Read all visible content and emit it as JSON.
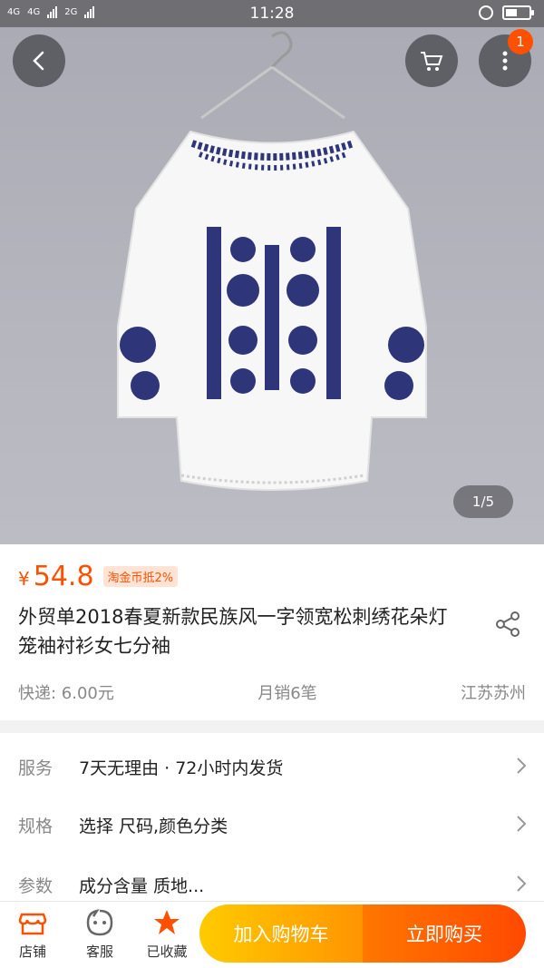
{
  "status_bar": {
    "network_left": "4G",
    "network_mid": "4G",
    "network_right": "2G",
    "time": "11:28"
  },
  "hero": {
    "image_counter": "1/5",
    "cart_badge": "1"
  },
  "product": {
    "currency": "¥",
    "price": "54.8",
    "coin_tag": "淘金币抵2%",
    "title": "外贸单2018春夏新款民族风一字领宽松刺绣花朵灯笼袖衬衫女七分袖",
    "shipping": "快递: 6.00元",
    "monthly_sales": "月销6笔",
    "location": "江苏苏州"
  },
  "options": [
    {
      "label": "服务",
      "value": "7天无理由 · 72小时内发货"
    },
    {
      "label": "规格",
      "value": "选择 尺码,颜色分类"
    },
    {
      "label": "参数",
      "value": "成分含量 质地..."
    }
  ],
  "bottom_bar": {
    "shop": "店铺",
    "service": "客服",
    "favorited": "已收藏",
    "add_to_cart": "加入购物车",
    "buy_now": "立即购买"
  },
  "colors": {
    "accent": "#ff5000",
    "cart_btn": "#ffa800",
    "buy_btn": "#ff5a00"
  }
}
